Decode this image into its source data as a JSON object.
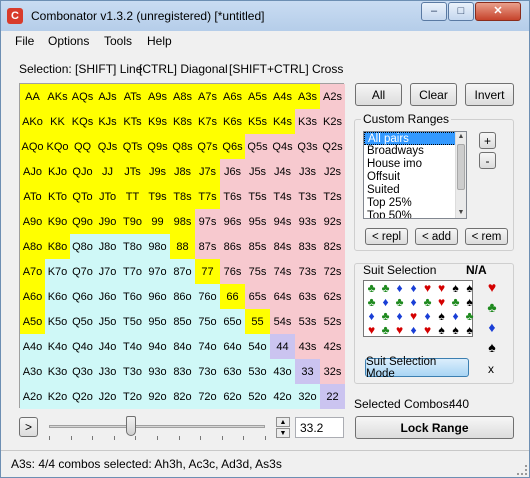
{
  "window": {
    "title": "Combonator v1.3.2 (unregistered) [*untitled]",
    "icon_letter": "C",
    "minimize": "–",
    "maximize": "□",
    "close": "✕"
  },
  "menu": {
    "file": "File",
    "options": "Options",
    "tools": "Tools",
    "help": "Help"
  },
  "selection": {
    "part1": "Selection: [SHIFT] Line",
    "part2": "[CTRL] Diagonal",
    "part3": "[SHIFT+CTRL] Cross"
  },
  "colors": {
    "selected": "#ffff00",
    "pair": "#cbc4f0",
    "suited": "#f7c9cf",
    "offsuit": "#cff8f7"
  },
  "hand_grid": {
    "rows": [
      [
        "AA",
        "AKs",
        "AQs",
        "AJs",
        "ATs",
        "A9s",
        "A8s",
        "A7s",
        "A6s",
        "A5s",
        "A4s",
        "A3s",
        "A2s"
      ],
      [
        "AKo",
        "KK",
        "KQs",
        "KJs",
        "KTs",
        "K9s",
        "K8s",
        "K7s",
        "K6s",
        "K5s",
        "K4s",
        "K3s",
        "K2s"
      ],
      [
        "AQo",
        "KQo",
        "QQ",
        "QJs",
        "QTs",
        "Q9s",
        "Q8s",
        "Q7s",
        "Q6s",
        "Q5s",
        "Q4s",
        "Q3s",
        "Q2s"
      ],
      [
        "AJo",
        "KJo",
        "QJo",
        "JJ",
        "JTs",
        "J9s",
        "J8s",
        "J7s",
        "J6s",
        "J5s",
        "J4s",
        "J3s",
        "J2s"
      ],
      [
        "ATo",
        "KTo",
        "QTo",
        "JTo",
        "TT",
        "T9s",
        "T8s",
        "T7s",
        "T6s",
        "T5s",
        "T4s",
        "T3s",
        "T2s"
      ],
      [
        "A9o",
        "K9o",
        "Q9o",
        "J9o",
        "T9o",
        "99",
        "98s",
        "97s",
        "96s",
        "95s",
        "94s",
        "93s",
        "92s"
      ],
      [
        "A8o",
        "K8o",
        "Q8o",
        "J8o",
        "T8o",
        "98o",
        "88",
        "87s",
        "86s",
        "85s",
        "84s",
        "83s",
        "82s"
      ],
      [
        "A7o",
        "K7o",
        "Q7o",
        "J7o",
        "T7o",
        "97o",
        "87o",
        "77",
        "76s",
        "75s",
        "74s",
        "73s",
        "72s"
      ],
      [
        "A6o",
        "K6o",
        "Q6o",
        "J6o",
        "T6o",
        "96o",
        "86o",
        "76o",
        "66",
        "65s",
        "64s",
        "63s",
        "62s"
      ],
      [
        "A5o",
        "K5o",
        "Q5o",
        "J5o",
        "T5o",
        "95o",
        "85o",
        "75o",
        "65o",
        "55",
        "54s",
        "53s",
        "52s"
      ],
      [
        "A4o",
        "K4o",
        "Q4o",
        "J4o",
        "T4o",
        "94o",
        "84o",
        "74o",
        "64o",
        "54o",
        "44",
        "43s",
        "42s"
      ],
      [
        "A3o",
        "K3o",
        "Q3o",
        "J3o",
        "T3o",
        "93o",
        "83o",
        "73o",
        "63o",
        "53o",
        "43o",
        "33",
        "32s"
      ],
      [
        "A2o",
        "K2o",
        "Q2o",
        "J2o",
        "T2o",
        "92o",
        "82o",
        "72o",
        "62o",
        "52o",
        "42o",
        "32o",
        "22"
      ]
    ],
    "selected": [
      [
        1,
        1,
        1,
        1,
        1,
        1,
        1,
        1,
        1,
        1,
        1,
        1,
        0
      ],
      [
        1,
        1,
        1,
        1,
        1,
        1,
        1,
        1,
        1,
        1,
        1,
        0,
        0
      ],
      [
        1,
        1,
        1,
        1,
        1,
        1,
        1,
        1,
        1,
        0,
        0,
        0,
        0
      ],
      [
        1,
        1,
        1,
        1,
        1,
        1,
        1,
        1,
        0,
        0,
        0,
        0,
        0
      ],
      [
        1,
        1,
        1,
        1,
        1,
        1,
        1,
        1,
        0,
        0,
        0,
        0,
        0
      ],
      [
        1,
        1,
        1,
        1,
        1,
        1,
        1,
        0,
        0,
        0,
        0,
        0,
        0
      ],
      [
        1,
        1,
        0,
        0,
        0,
        0,
        1,
        0,
        0,
        0,
        0,
        0,
        0
      ],
      [
        1,
        0,
        0,
        0,
        0,
        0,
        0,
        1,
        0,
        0,
        0,
        0,
        0
      ],
      [
        1,
        0,
        0,
        0,
        0,
        0,
        0,
        0,
        1,
        0,
        0,
        0,
        0
      ],
      [
        1,
        0,
        0,
        0,
        0,
        0,
        0,
        0,
        0,
        1,
        0,
        0,
        0
      ],
      [
        0,
        0,
        0,
        0,
        0,
        0,
        0,
        0,
        0,
        0,
        0,
        0,
        0
      ],
      [
        0,
        0,
        0,
        0,
        0,
        0,
        0,
        0,
        0,
        0,
        0,
        0,
        0
      ],
      [
        0,
        0,
        0,
        0,
        0,
        0,
        0,
        0,
        0,
        0,
        0,
        0,
        0
      ]
    ]
  },
  "buttons": {
    "all": "All",
    "clear": "Clear",
    "invert": "Invert",
    "repl": "< repl",
    "add": "< add",
    "rem": "< rem",
    "plus": "+",
    "minus": "-",
    "suit_mode": "Suit Selection Mode",
    "lock_range": "Lock Range",
    "play": ">"
  },
  "custom_ranges": {
    "label": "Custom Ranges",
    "items": [
      "All pairs",
      "Broadways",
      "House imo",
      "Offsuit",
      "Suited",
      "Top 25%",
      "Top 50%"
    ],
    "selected_index": 0
  },
  "suit_selection": {
    "label": "Suit Selection",
    "status": "N/A",
    "x_label": "x",
    "grid": [
      [
        "♣",
        "♣",
        "♦",
        "♦",
        "♥",
        "♥",
        "♠",
        "♠"
      ],
      [
        "♣",
        "♦",
        "♣",
        "♦",
        "♣",
        "♥",
        "♣",
        "♠"
      ],
      [
        "♦",
        "♣",
        "♦",
        "♥",
        "♦",
        "♠",
        "♦",
        "♣"
      ],
      [
        "♥",
        "♣",
        "♥",
        "♦",
        "♥",
        "♠",
        "♠",
        "♠"
      ]
    ],
    "side": [
      "♥",
      "♣",
      "♦",
      "♠"
    ]
  },
  "slider": {
    "value": "33.2",
    "level_percent": 38
  },
  "combos": {
    "label": "Selected Combos:",
    "value": "440"
  },
  "statusbar": {
    "text": "A3s: 4/4 combos selected: Ah3h, Ac3c, Ad3d, As3s"
  },
  "icons": {
    "app": "app-icon",
    "spin_up": "chevron-up-icon",
    "spin_down": "chevron-down-icon"
  }
}
